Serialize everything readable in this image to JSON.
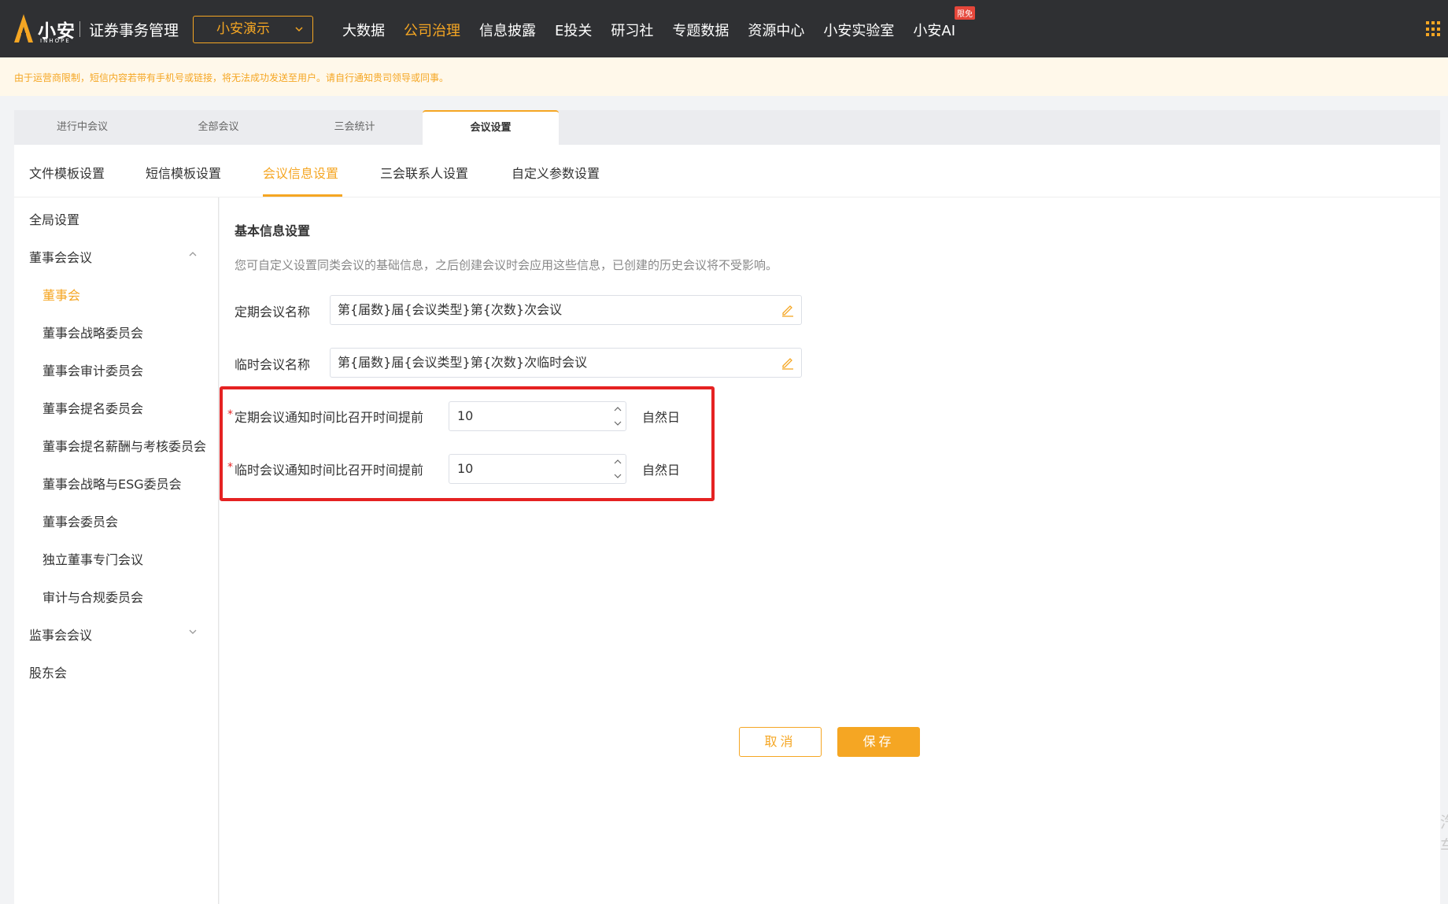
{
  "header": {
    "logo_text": "小安",
    "logo_sub": "INHOPE",
    "system_title": "证券事务管理",
    "org_select": "小安演示",
    "nav": [
      {
        "label": "大数据"
      },
      {
        "label": "公司治理",
        "active": true
      },
      {
        "label": "信息披露"
      },
      {
        "label": "E投关"
      },
      {
        "label": "研习社"
      },
      {
        "label": "专题数据"
      },
      {
        "label": "资源中心"
      },
      {
        "label": "小安实验室"
      },
      {
        "label": "小安AI"
      }
    ],
    "ai_badge": "限免"
  },
  "notice": "由于运营商限制，短信内容若带有手机号或链接，将无法成功发送至用户。请自行通知贵司领导或同事。",
  "main_tabs": [
    "进行中会议",
    "全部会议",
    "三会统计",
    "会议设置"
  ],
  "main_tab_active": 3,
  "sub_tabs": [
    "文件模板设置",
    "短信模板设置",
    "会议信息设置",
    "三会联系人设置",
    "自定义参数设置"
  ],
  "sub_tab_active": 2,
  "sidebar": {
    "global": "全局设置",
    "board_group": "董事会会议",
    "board_children": [
      "董事会",
      "董事会战略委员会",
      "董事会审计委员会",
      "董事会提名委员会",
      "董事会提名薪酬与考核委员会",
      "董事会战略与ESG委员会",
      "董事会委员会",
      "独立董事专门会议",
      "审计与合规委员会"
    ],
    "board_active": 0,
    "supervisor_group": "监事会会议",
    "shareholder": "股东会"
  },
  "content": {
    "section_title": "基本信息设置",
    "section_desc": "您可自定义设置同类会议的基础信息，之后创建会议时会应用这些信息，已创建的历史会议将不受影响。",
    "regular_name_label": "定期会议名称",
    "regular_name_value": "第{届数}届{会议类型}第{次数}次会议",
    "temp_name_label": "临时会议名称",
    "temp_name_value": "第{届数}届{会议类型}第{次数}次临时会议",
    "regular_notice_label": "定期会议通知时间比召开时间提前",
    "regular_notice_value": "10",
    "temp_notice_label": "临时会议通知时间比召开时间提前",
    "temp_notice_value": "10",
    "unit": "自然日",
    "required_mark": "*",
    "cancel": "取消",
    "save": "保存"
  },
  "edge_text": "汽车",
  "colors": {
    "accent": "#f5a623",
    "nav_bg": "#2f3033",
    "highlight": "#e52222"
  }
}
